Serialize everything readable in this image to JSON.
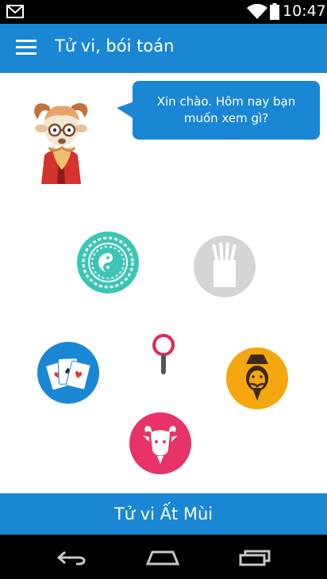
{
  "status_bar": {
    "time": "10:47",
    "icons": [
      "gmail-icon",
      "wifi-icon",
      "battery-icon"
    ]
  },
  "app_bar": {
    "title": "Tử vi, bói toán",
    "menu_icon": "hamburger-menu-icon"
  },
  "greeting": {
    "message": "Xin chào. Hôm nay bạn muốn xem gì?"
  },
  "features": [
    {
      "icon": "zodiac-wheel-icon",
      "color": "#3bc6b3"
    },
    {
      "icon": "fortune-sticks-icon",
      "color": "#d5d5d5"
    },
    {
      "icon": "playing-cards-icon",
      "color": "#1a87d4"
    },
    {
      "icon": "magnifier-icon",
      "color": "#e62552"
    },
    {
      "icon": "sage-face-icon",
      "color": "#f6a60e"
    },
    {
      "icon": "goat-zodiac-icon",
      "color": "#e8336a"
    }
  ],
  "bottom_bar": {
    "label": "Tử vi Ất Mùi"
  },
  "colors": {
    "primary": "#1a87d4",
    "background": "#ffffff"
  }
}
